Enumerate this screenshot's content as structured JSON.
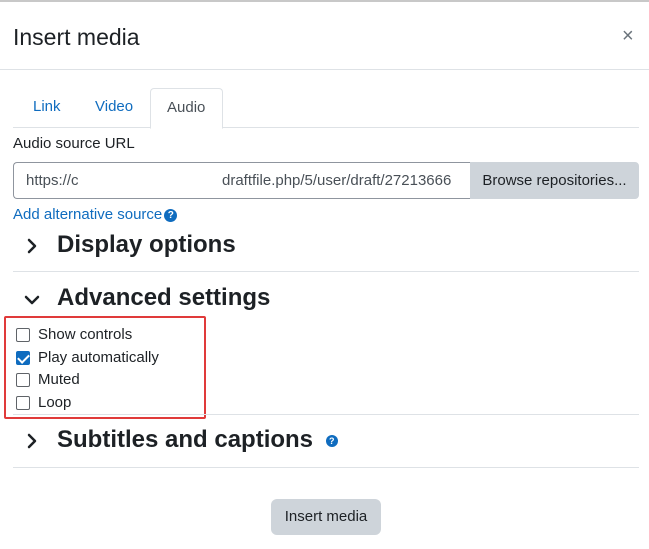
{
  "dialog": {
    "title": "Insert media",
    "close_glyph": "×"
  },
  "tabs": [
    {
      "label": "Link",
      "active": false
    },
    {
      "label": "Video",
      "active": false
    },
    {
      "label": "Audio",
      "active": true
    }
  ],
  "source": {
    "label": "Audio source URL",
    "url_start": "https://c",
    "url_end": "draftfile.php/5/user/draft/27213666",
    "browse_label": "Browse repositories..."
  },
  "alt_source": {
    "label": "Add alternative source",
    "help_glyph": "?"
  },
  "sections": {
    "display": {
      "title": "Display options",
      "expanded": false
    },
    "advanced": {
      "title": "Advanced settings",
      "expanded": true
    },
    "subtitles": {
      "title": "Subtitles and captions",
      "expanded": false,
      "help_glyph": "?"
    }
  },
  "advanced_options": [
    {
      "label": "Show controls",
      "checked": false
    },
    {
      "label": "Play automatically",
      "checked": true
    },
    {
      "label": "Muted",
      "checked": false
    },
    {
      "label": "Loop",
      "checked": false
    }
  ],
  "footer": {
    "insert_label": "Insert media"
  },
  "colors": {
    "link": "#0f6cbf",
    "highlight": "#e03a3a",
    "button_bg": "#ced4da"
  },
  "icons": {
    "chevron_collapsed": "›",
    "chevron_expanded": "⌄"
  }
}
